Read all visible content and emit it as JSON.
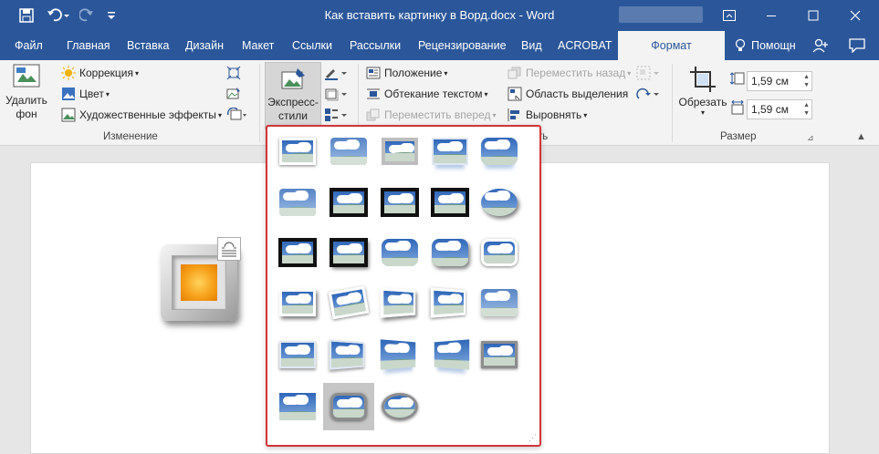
{
  "window": {
    "title": "Как вставить картинку в Ворд.docx - Word",
    "colors": {
      "titlebar": "#2b579a",
      "accent_red": "#d13438"
    }
  },
  "quick_access": {
    "icons": [
      "save-icon",
      "undo-icon",
      "redo-icon",
      "customize-icon"
    ]
  },
  "tabs": [
    "Файл",
    "Главная",
    "Вставка",
    "Дизайн",
    "Макет",
    "Ссылки",
    "Рассылки",
    "Рецензирование",
    "Вид",
    "ACROBAT",
    "Формат"
  ],
  "active_tab": "Формат",
  "tell_me": "Помощн",
  "ribbon": {
    "adjust": {
      "remove_bg": "Удалить\nфон",
      "correction": "Коррекция",
      "color": "Цвет",
      "artistic": "Художественные эффекты",
      "group_label": "Изменение"
    },
    "styles": {
      "quick_styles": "Экспресс-\nстили",
      "group_label_fragment": "ть"
    },
    "arrange": {
      "position": "Положение",
      "wrap_text": "Обтекание текстом",
      "bring_forward": "Переместить вперед",
      "send_backward": "Переместить назад",
      "selection_pane": "Область выделения",
      "align": "Выровнять"
    },
    "size": {
      "crop": "Обрезать",
      "height": "1,59 см",
      "width": "1,59 см",
      "group_label": "Размер"
    }
  },
  "gallery": {
    "rows": 6,
    "selected_index": 26,
    "styles": [
      "simple-frame-white",
      "soft-edge-rectangle",
      "simple-frame-grey",
      "reflected-bevel-white",
      "reflected-rounded-rectangle",
      "soft-edge-rectangle-2",
      "double-frame-black",
      "thick-matte-black",
      "simple-frame-black",
      "oval-shadow",
      "compound-frame-black",
      "center-shadow-black",
      "rounded-diagonal-corner",
      "drop-shadow-rounded",
      "rounded-white",
      "rectangle-white-shadow",
      "rotated-white",
      "perspective-shadow-white",
      "relaxed-perspective-white",
      "soft-edge-oval",
      "bevel-rectangle",
      "bevel-perspective",
      "reflected-perspective-right",
      "reflected-perspective-left",
      "metal-frame",
      "snip-diagonal-corner",
      "metal-rounded-rectangle",
      "metal-oval"
    ]
  }
}
